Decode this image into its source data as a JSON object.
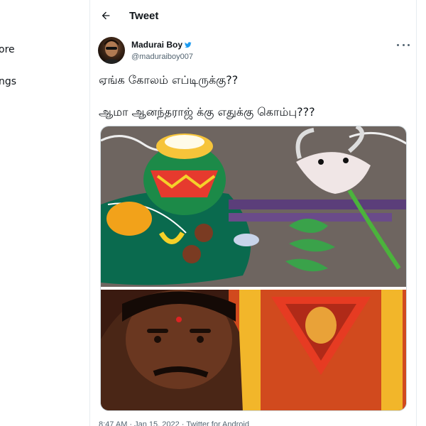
{
  "sidebar": {
    "more_label": "ore",
    "settings_label": "ngs"
  },
  "header": {
    "title": "Tweet",
    "back_icon": "arrow-left-icon"
  },
  "tweet": {
    "author": {
      "display_name": "Madurai Boy",
      "handle": "@maduraiboy007",
      "avatar_icon": "avatar"
    },
    "lines": [
      "ஏங்க கோலம் எப்டிருக்கு??",
      "ஆமா ஆனந்தராஜ் க்கு எதுக்கு கொம்பு???"
    ],
    "footer_partial": "8:47 AM · Jan 15, 2022 · Twitter for Android"
  },
  "colors": {
    "accent": "#1d9bf0",
    "text": "#0f1419",
    "muted": "#536471",
    "border": "#e6ecf0"
  }
}
